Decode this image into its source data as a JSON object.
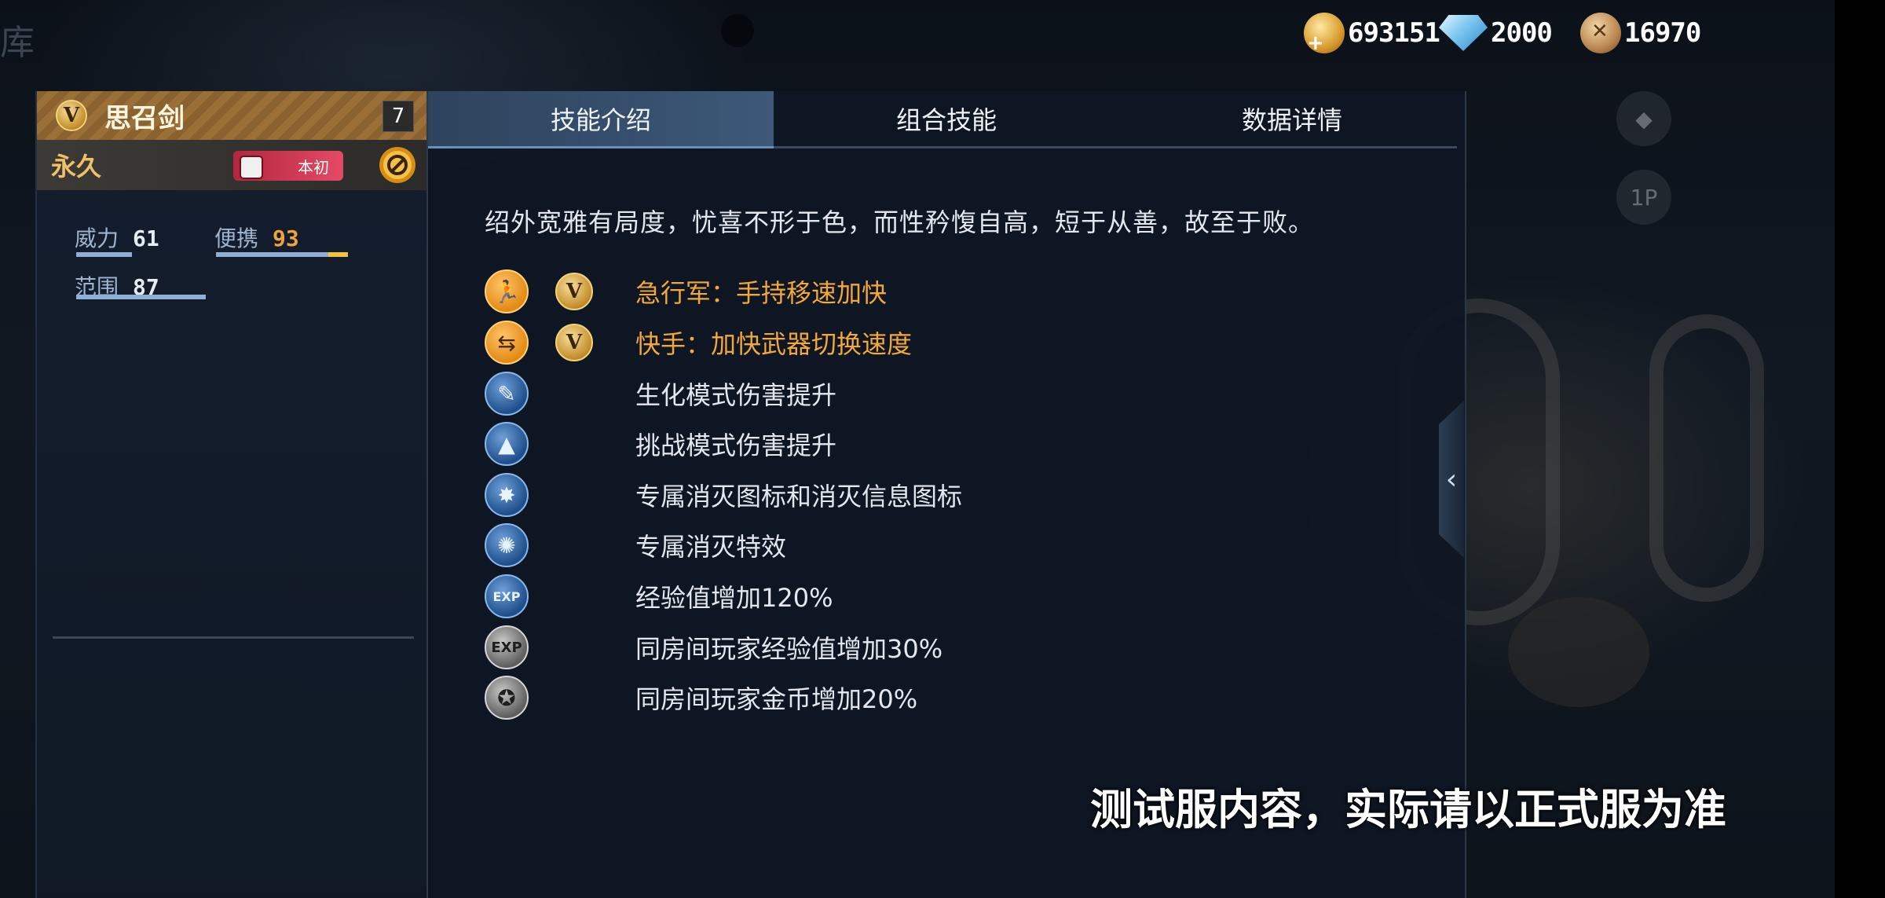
{
  "background": {
    "edge_char": "库",
    "icon_1p": "1P"
  },
  "currency": [
    {
      "icon": "gold-coin-plus-icon",
      "value": "693151"
    },
    {
      "icon": "diamond-plus-icon",
      "value": "2000"
    },
    {
      "icon": "bronze-medal-icon",
      "value": "16970"
    }
  ],
  "weapon": {
    "tier_badge": "V",
    "name": "思召剑",
    "level": "7",
    "duration": "永久",
    "origin_tag": "本初",
    "stats": [
      {
        "label": "威力",
        "value": "61",
        "fraction": 0.61
      },
      {
        "label": "便携",
        "value": "93",
        "fraction": 0.93
      },
      {
        "label": "范围",
        "value": "87",
        "fraction": 0.87
      }
    ]
  },
  "tabs": [
    "技能介绍",
    "组合技能",
    "数据详情"
  ],
  "active_tab": 0,
  "description": "绍外宽雅有局度，忧喜不形于色，而性矜愎自高，短于从善，故至于败。",
  "skills": [
    {
      "icon": "running-icon",
      "text": "急行军：手持移速加快",
      "highlight": true
    },
    {
      "icon": "weapon-swap-icon",
      "text": "快手：加快武器切换速度",
      "highlight": true
    },
    {
      "icon": "biochemical-mode-icon",
      "text": "生化模式伤害提升",
      "highlight": false
    },
    {
      "icon": "challenge-mode-icon",
      "text": "挑战模式伤害提升",
      "highlight": false
    },
    {
      "icon": "kill-icon-emblem",
      "text": "专属消灭图标和消灭信息图标",
      "highlight": false
    },
    {
      "icon": "kill-effect-icon",
      "text": "专属消灭特效",
      "highlight": false
    },
    {
      "icon": "exp-icon",
      "text": "经验值增加120%",
      "highlight": false
    },
    {
      "icon": "room-exp-icon",
      "text": "同房间玩家经验值增加30%",
      "highlight": false
    },
    {
      "icon": "room-gold-icon",
      "text": "同房间玩家金币增加20%",
      "highlight": false
    }
  ],
  "skill_glyphs": {
    "exp": "EXP"
  },
  "disclaimer": "测试服内容，实际请以正式服为准",
  "colors": {
    "accent_orange": "#f3a83b",
    "tab_active": "#3d5879",
    "panel_bg": "#0f1723"
  }
}
